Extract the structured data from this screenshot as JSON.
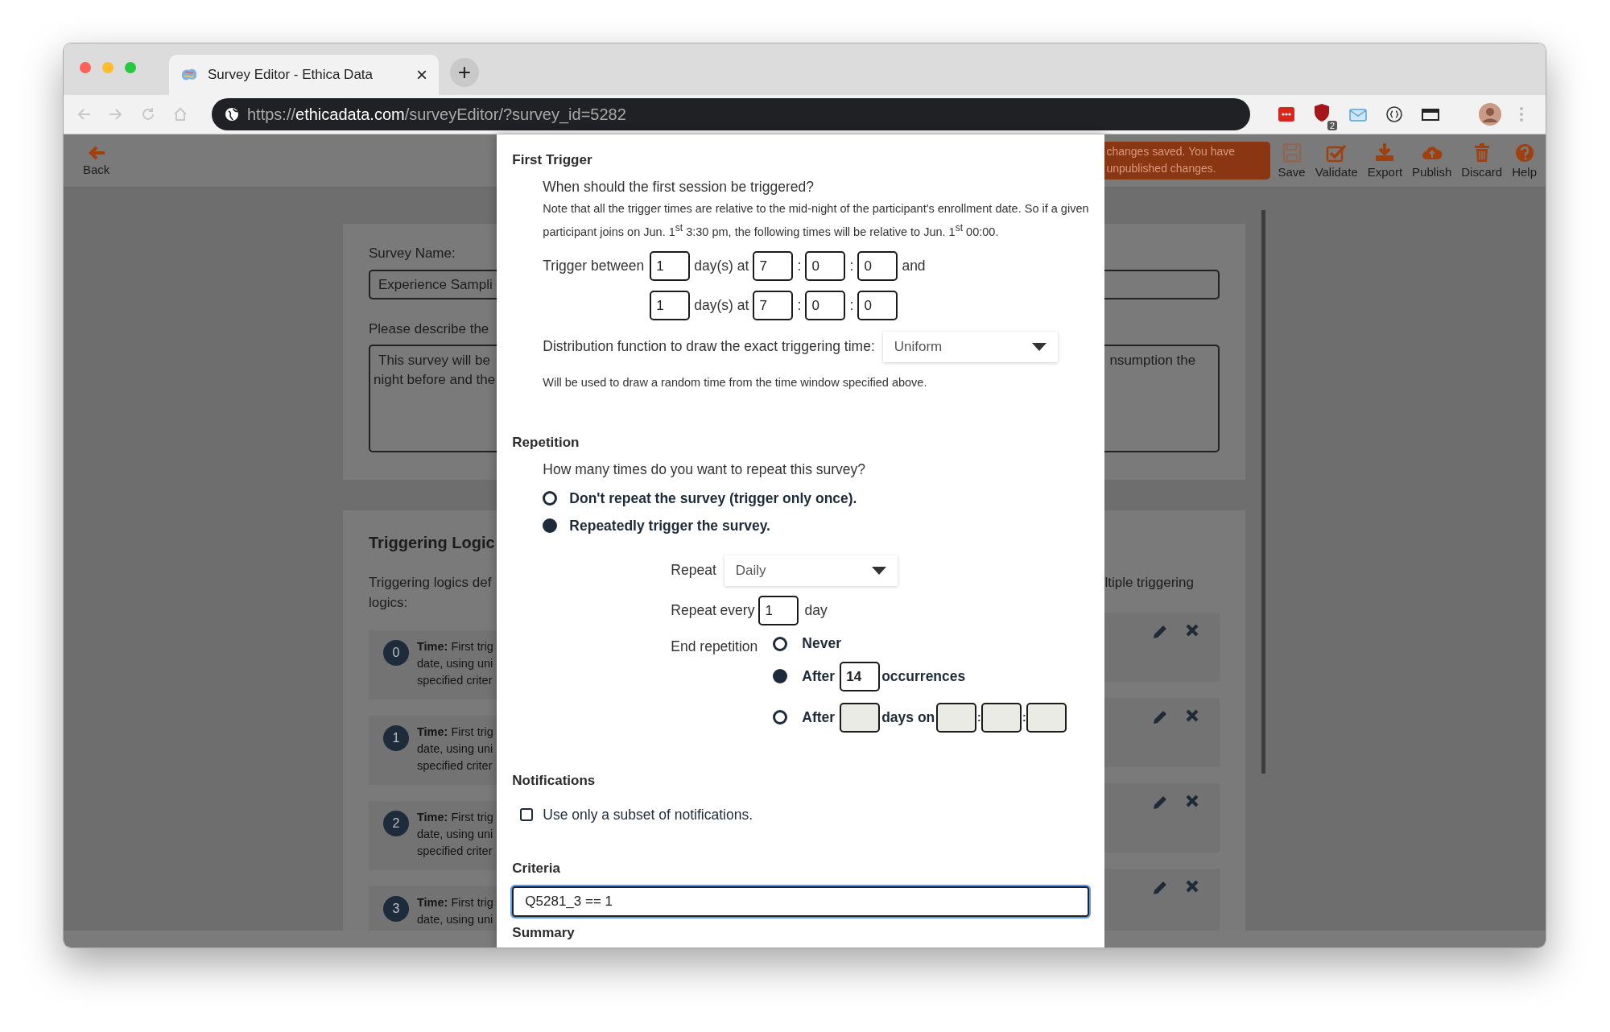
{
  "browser": {
    "tab_title": "Survey Editor - Ethica Data",
    "tab_close": "×",
    "new_tab": "+",
    "url_scheme": "https://",
    "url_host": "ethicadata.com",
    "url_path": "/surveyEditor/?survey_id=5282",
    "extension_badge": "2"
  },
  "toolbar": {
    "back": "Back",
    "notice": "changes saved. You have unpublished changes.",
    "actions": [
      {
        "kind": "save",
        "label": "Save",
        "disabled": true
      },
      {
        "kind": "validate",
        "label": "Validate",
        "disabled": false
      },
      {
        "kind": "export",
        "label": "Export",
        "disabled": false
      },
      {
        "kind": "publish",
        "label": "Publish",
        "disabled": false
      },
      {
        "kind": "discard",
        "label": "Discard",
        "disabled": false
      },
      {
        "kind": "help",
        "label": "Help",
        "disabled": false
      }
    ]
  },
  "background": {
    "survey_name_label": "Survey Name:",
    "survey_name_value": "Experience Sampli",
    "description_label": "Please describe the",
    "description_left": [
      "This survey will be",
      "night before and the"
    ],
    "description_right": "nsumption the",
    "triggering_title": "Triggering Logic",
    "triggering_intro_left": [
      "Triggering logics def",
      "logics:"
    ],
    "triggering_intro_right": "ltiple triggering",
    "logics": [
      {
        "index": "0",
        "lines": [
          "**Time:** First trig",
          "date, using uni",
          "specified criter"
        ]
      },
      {
        "index": "1",
        "lines": [
          "**Time:** First trig",
          "date, using uni",
          "specified criter"
        ]
      },
      {
        "index": "2",
        "lines": [
          "**Time:** First trig",
          "date, using uni",
          "specified criter"
        ]
      },
      {
        "index": "3",
        "lines": [
          "**Time:** First trig",
          "date, using uni"
        ]
      }
    ]
  },
  "modal": {
    "first_trigger": {
      "title": "First Trigger",
      "question": "When should the first session be triggered?",
      "note": "Note that all the trigger times are relative to the mid-night of the participant's enrollment date. So if a given participant joins on Jun. 1$^{st}$ 3:30 pm, the following times will be relative to Jun. 1$^{st}$ 00:00.",
      "rows": [
        {
          "label": "Trigger between",
          "days": "1",
          "days_unit": "day(s) at",
          "time": [
            {
              "value": "7"
            },
            {
              "sep": ":",
              "value": "0"
            },
            {
              "sep": ":",
              "value": "0"
            }
          ],
          "suffix": "and"
        },
        {
          "days": "1",
          "days_unit": "day(s) at",
          "time": [
            {
              "value": "7"
            },
            {
              "sep": ":",
              "value": "0"
            },
            {
              "sep": ":",
              "value": "0"
            }
          ]
        }
      ],
      "distribution": {
        "label": "Distribution function to draw the exact triggering time:",
        "value": "Uniform",
        "hint": "Will be used to draw a random time from the time window specified above."
      }
    },
    "repetition": {
      "title": "Repetition",
      "question": "How many times do you want to repeat this survey?",
      "options": [
        {
          "label": "Don't repeat the survey (trigger only once).",
          "selected": false
        },
        {
          "label": "Repeatedly trigger the survey.",
          "selected": true
        }
      ],
      "repeat": {
        "label": "Repeat",
        "value": "Daily"
      },
      "every": {
        "label": "Repeat every",
        "value": "1",
        "unit": "day"
      },
      "end": {
        "label": "End repetition",
        "options": [
          {
            "kind": "never",
            "label": "Never",
            "selected": false
          },
          {
            "kind": "count",
            "label": "After",
            "value": "14",
            "unit": "occurrences",
            "selected": true
          },
          {
            "kind": "date",
            "label": "After",
            "unit": "days on",
            "time_separators": [
              ":",
              ":"
            ],
            "selected": false,
            "disabled": true
          }
        ]
      }
    },
    "notifications": {
      "title": "Notifications",
      "option": {
        "label": "Use only a subset of notifications.",
        "checked": false
      }
    },
    "criteria": {
      "title": "Criteria",
      "value": "Q5281_3 == 1",
      "focused": true
    },
    "summary": {
      "title": "Summary"
    }
  }
}
